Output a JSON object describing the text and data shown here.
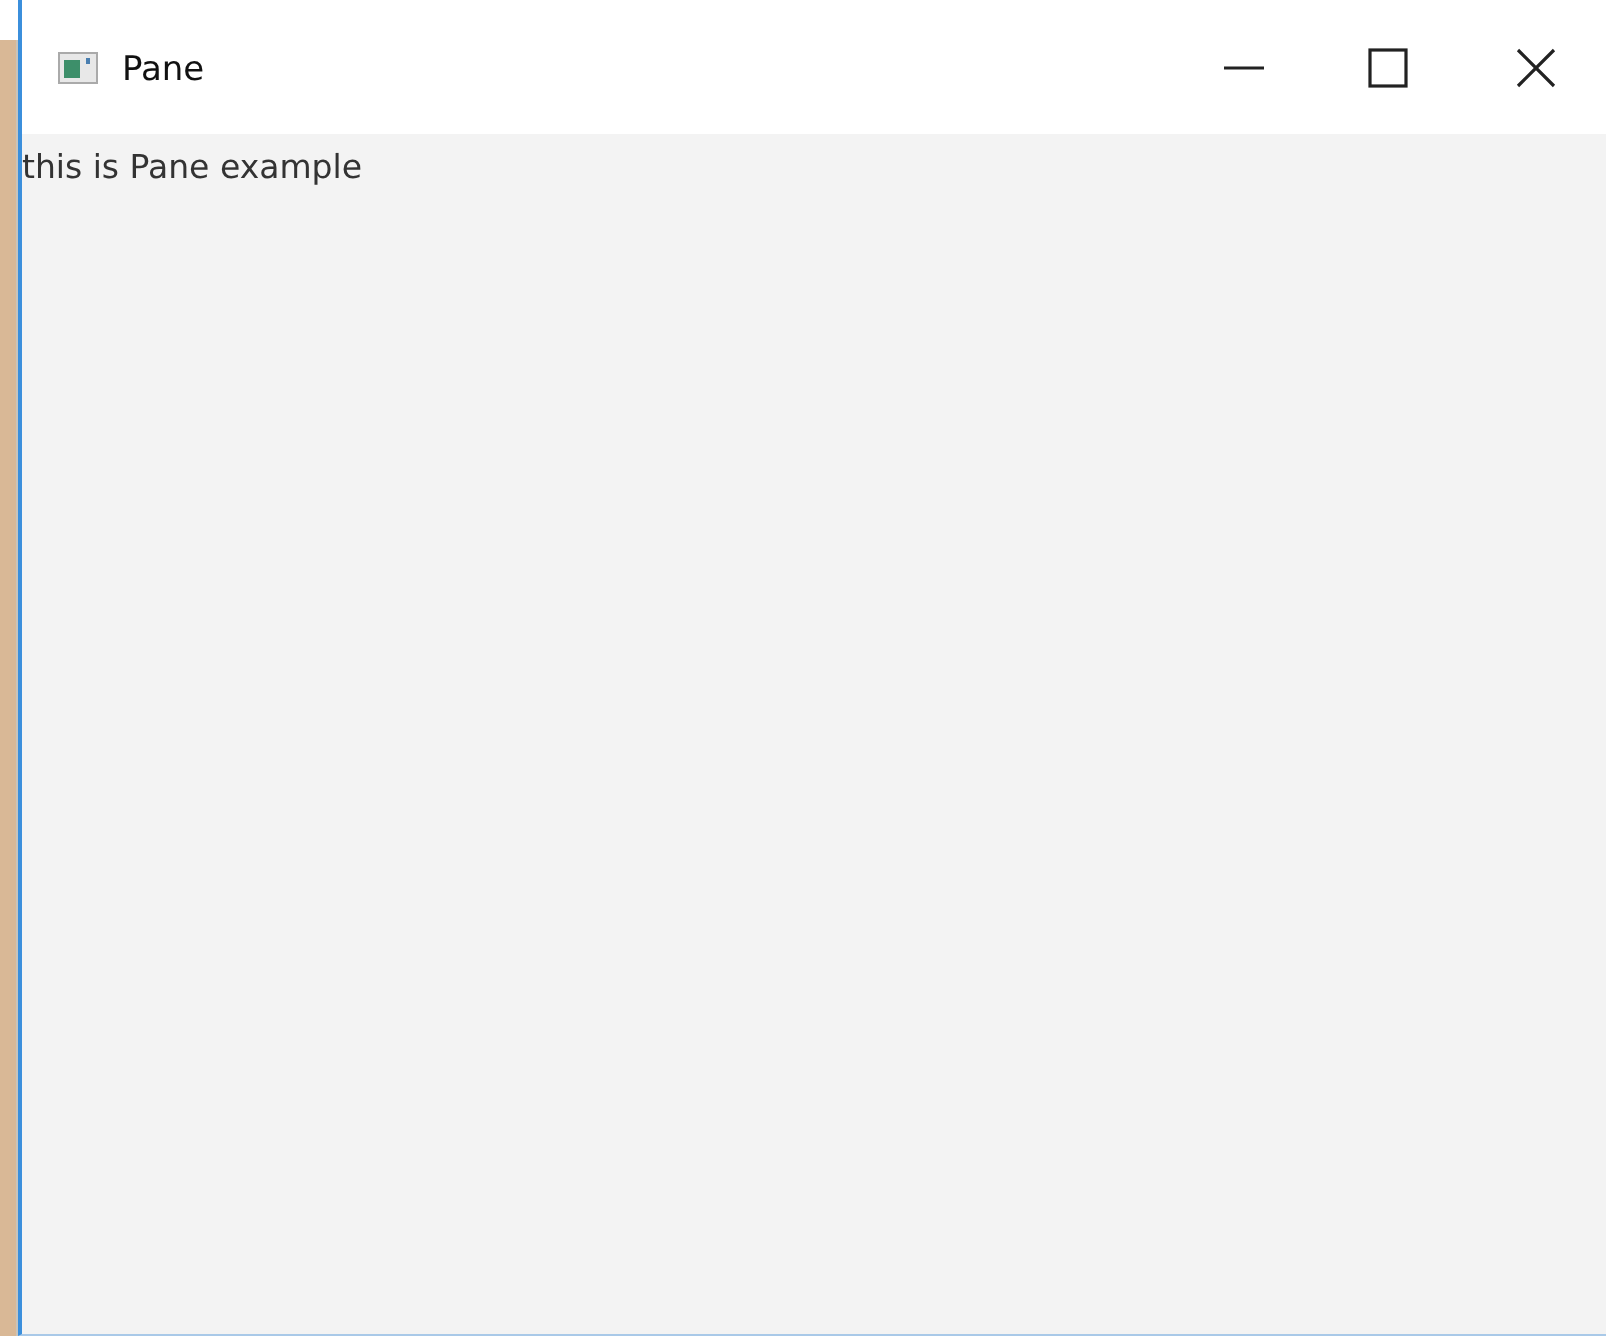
{
  "window": {
    "title": "Pane"
  },
  "content": {
    "label": "this is Pane example"
  }
}
